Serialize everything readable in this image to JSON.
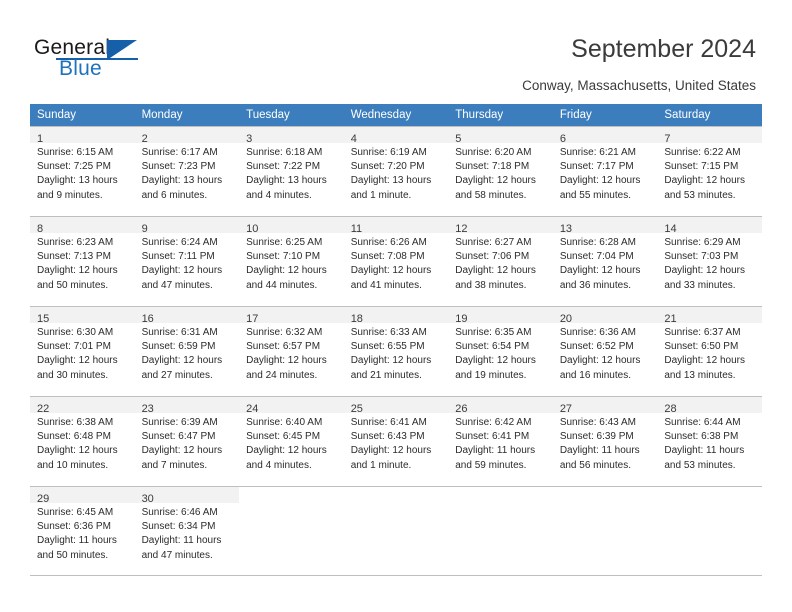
{
  "brand": {
    "name_primary": "General",
    "name_secondary": "Blue",
    "accent_color": "#1560a8",
    "text_color": "#1a1a1a"
  },
  "header": {
    "title": "September 2024",
    "location": "Conway, Massachusetts, United States"
  },
  "calendar": {
    "header_bg": "#3c7ebd",
    "daynum_bg": "#f2f2f2",
    "border_color": "#bfbfbf",
    "weekday_headers": [
      "Sunday",
      "Monday",
      "Tuesday",
      "Wednesday",
      "Thursday",
      "Friday",
      "Saturday"
    ],
    "weeks": [
      [
        {
          "day": "1",
          "sunrise": "Sunrise: 6:15 AM",
          "sunset": "Sunset: 7:25 PM",
          "daylight_line1": "Daylight: 13 hours",
          "daylight_line2": "and 9 minutes."
        },
        {
          "day": "2",
          "sunrise": "Sunrise: 6:17 AM",
          "sunset": "Sunset: 7:23 PM",
          "daylight_line1": "Daylight: 13 hours",
          "daylight_line2": "and 6 minutes."
        },
        {
          "day": "3",
          "sunrise": "Sunrise: 6:18 AM",
          "sunset": "Sunset: 7:22 PM",
          "daylight_line1": "Daylight: 13 hours",
          "daylight_line2": "and 4 minutes."
        },
        {
          "day": "4",
          "sunrise": "Sunrise: 6:19 AM",
          "sunset": "Sunset: 7:20 PM",
          "daylight_line1": "Daylight: 13 hours",
          "daylight_line2": "and 1 minute."
        },
        {
          "day": "5",
          "sunrise": "Sunrise: 6:20 AM",
          "sunset": "Sunset: 7:18 PM",
          "daylight_line1": "Daylight: 12 hours",
          "daylight_line2": "and 58 minutes."
        },
        {
          "day": "6",
          "sunrise": "Sunrise: 6:21 AM",
          "sunset": "Sunset: 7:17 PM",
          "daylight_line1": "Daylight: 12 hours",
          "daylight_line2": "and 55 minutes."
        },
        {
          "day": "7",
          "sunrise": "Sunrise: 6:22 AM",
          "sunset": "Sunset: 7:15 PM",
          "daylight_line1": "Daylight: 12 hours",
          "daylight_line2": "and 53 minutes."
        }
      ],
      [
        {
          "day": "8",
          "sunrise": "Sunrise: 6:23 AM",
          "sunset": "Sunset: 7:13 PM",
          "daylight_line1": "Daylight: 12 hours",
          "daylight_line2": "and 50 minutes."
        },
        {
          "day": "9",
          "sunrise": "Sunrise: 6:24 AM",
          "sunset": "Sunset: 7:11 PM",
          "daylight_line1": "Daylight: 12 hours",
          "daylight_line2": "and 47 minutes."
        },
        {
          "day": "10",
          "sunrise": "Sunrise: 6:25 AM",
          "sunset": "Sunset: 7:10 PM",
          "daylight_line1": "Daylight: 12 hours",
          "daylight_line2": "and 44 minutes."
        },
        {
          "day": "11",
          "sunrise": "Sunrise: 6:26 AM",
          "sunset": "Sunset: 7:08 PM",
          "daylight_line1": "Daylight: 12 hours",
          "daylight_line2": "and 41 minutes."
        },
        {
          "day": "12",
          "sunrise": "Sunrise: 6:27 AM",
          "sunset": "Sunset: 7:06 PM",
          "daylight_line1": "Daylight: 12 hours",
          "daylight_line2": "and 38 minutes."
        },
        {
          "day": "13",
          "sunrise": "Sunrise: 6:28 AM",
          "sunset": "Sunset: 7:04 PM",
          "daylight_line1": "Daylight: 12 hours",
          "daylight_line2": "and 36 minutes."
        },
        {
          "day": "14",
          "sunrise": "Sunrise: 6:29 AM",
          "sunset": "Sunset: 7:03 PM",
          "daylight_line1": "Daylight: 12 hours",
          "daylight_line2": "and 33 minutes."
        }
      ],
      [
        {
          "day": "15",
          "sunrise": "Sunrise: 6:30 AM",
          "sunset": "Sunset: 7:01 PM",
          "daylight_line1": "Daylight: 12 hours",
          "daylight_line2": "and 30 minutes."
        },
        {
          "day": "16",
          "sunrise": "Sunrise: 6:31 AM",
          "sunset": "Sunset: 6:59 PM",
          "daylight_line1": "Daylight: 12 hours",
          "daylight_line2": "and 27 minutes."
        },
        {
          "day": "17",
          "sunrise": "Sunrise: 6:32 AM",
          "sunset": "Sunset: 6:57 PM",
          "daylight_line1": "Daylight: 12 hours",
          "daylight_line2": "and 24 minutes."
        },
        {
          "day": "18",
          "sunrise": "Sunrise: 6:33 AM",
          "sunset": "Sunset: 6:55 PM",
          "daylight_line1": "Daylight: 12 hours",
          "daylight_line2": "and 21 minutes."
        },
        {
          "day": "19",
          "sunrise": "Sunrise: 6:35 AM",
          "sunset": "Sunset: 6:54 PM",
          "daylight_line1": "Daylight: 12 hours",
          "daylight_line2": "and 19 minutes."
        },
        {
          "day": "20",
          "sunrise": "Sunrise: 6:36 AM",
          "sunset": "Sunset: 6:52 PM",
          "daylight_line1": "Daylight: 12 hours",
          "daylight_line2": "and 16 minutes."
        },
        {
          "day": "21",
          "sunrise": "Sunrise: 6:37 AM",
          "sunset": "Sunset: 6:50 PM",
          "daylight_line1": "Daylight: 12 hours",
          "daylight_line2": "and 13 minutes."
        }
      ],
      [
        {
          "day": "22",
          "sunrise": "Sunrise: 6:38 AM",
          "sunset": "Sunset: 6:48 PM",
          "daylight_line1": "Daylight: 12 hours",
          "daylight_line2": "and 10 minutes."
        },
        {
          "day": "23",
          "sunrise": "Sunrise: 6:39 AM",
          "sunset": "Sunset: 6:47 PM",
          "daylight_line1": "Daylight: 12 hours",
          "daylight_line2": "and 7 minutes."
        },
        {
          "day": "24",
          "sunrise": "Sunrise: 6:40 AM",
          "sunset": "Sunset: 6:45 PM",
          "daylight_line1": "Daylight: 12 hours",
          "daylight_line2": "and 4 minutes."
        },
        {
          "day": "25",
          "sunrise": "Sunrise: 6:41 AM",
          "sunset": "Sunset: 6:43 PM",
          "daylight_line1": "Daylight: 12 hours",
          "daylight_line2": "and 1 minute."
        },
        {
          "day": "26",
          "sunrise": "Sunrise: 6:42 AM",
          "sunset": "Sunset: 6:41 PM",
          "daylight_line1": "Daylight: 11 hours",
          "daylight_line2": "and 59 minutes."
        },
        {
          "day": "27",
          "sunrise": "Sunrise: 6:43 AM",
          "sunset": "Sunset: 6:39 PM",
          "daylight_line1": "Daylight: 11 hours",
          "daylight_line2": "and 56 minutes."
        },
        {
          "day": "28",
          "sunrise": "Sunrise: 6:44 AM",
          "sunset": "Sunset: 6:38 PM",
          "daylight_line1": "Daylight: 11 hours",
          "daylight_line2": "and 53 minutes."
        }
      ],
      [
        {
          "day": "29",
          "sunrise": "Sunrise: 6:45 AM",
          "sunset": "Sunset: 6:36 PM",
          "daylight_line1": "Daylight: 11 hours",
          "daylight_line2": "and 50 minutes."
        },
        {
          "day": "30",
          "sunrise": "Sunrise: 6:46 AM",
          "sunset": "Sunset: 6:34 PM",
          "daylight_line1": "Daylight: 11 hours",
          "daylight_line2": "and 47 minutes."
        },
        {
          "day": "",
          "sunrise": "",
          "sunset": "",
          "daylight_line1": "",
          "daylight_line2": ""
        },
        {
          "day": "",
          "sunrise": "",
          "sunset": "",
          "daylight_line1": "",
          "daylight_line2": ""
        },
        {
          "day": "",
          "sunrise": "",
          "sunset": "",
          "daylight_line1": "",
          "daylight_line2": ""
        },
        {
          "day": "",
          "sunrise": "",
          "sunset": "",
          "daylight_line1": "",
          "daylight_line2": ""
        },
        {
          "day": "",
          "sunrise": "",
          "sunset": "",
          "daylight_line1": "",
          "daylight_line2": ""
        }
      ]
    ]
  }
}
